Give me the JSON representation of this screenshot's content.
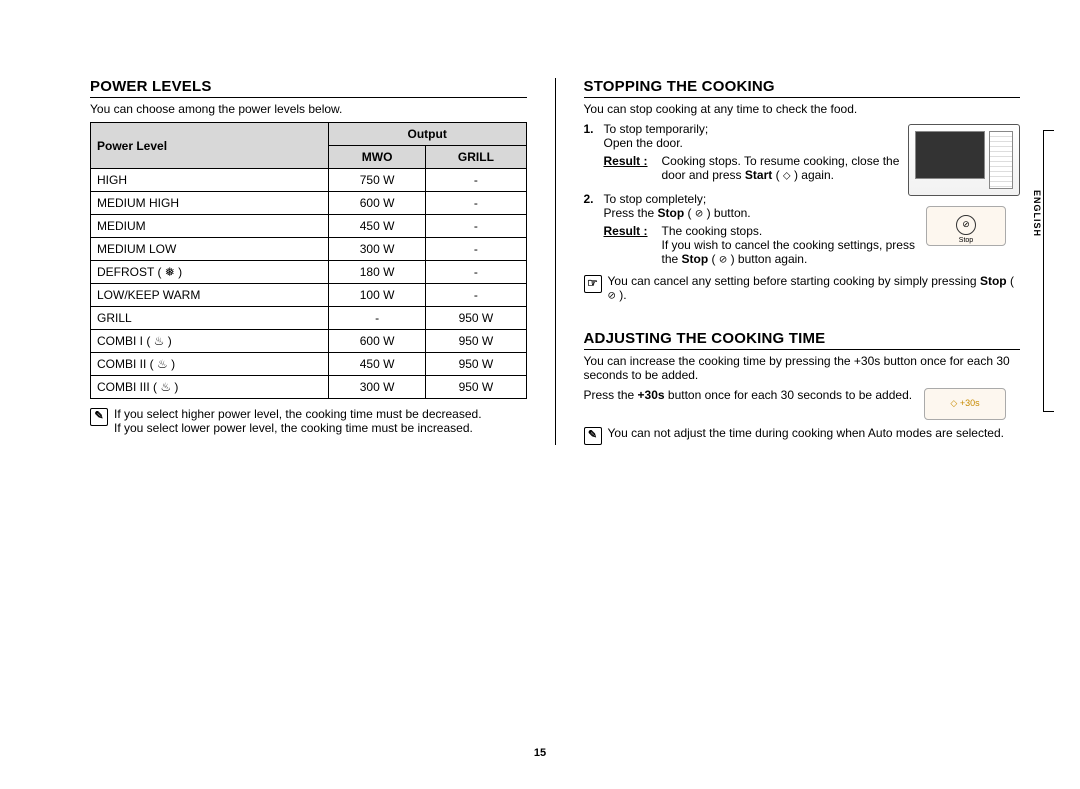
{
  "page_number": "15",
  "side_language": "ENGLISH",
  "left": {
    "heading": "POWER LEVELS",
    "intro": "You can choose among the power levels below.",
    "table": {
      "header_level": "Power Level",
      "header_output": "Output",
      "header_mwo": "MWO",
      "header_grill": "GRILL",
      "rows": [
        {
          "level": "HIGH",
          "mwo": "750 W",
          "grill": "-"
        },
        {
          "level": "MEDIUM HIGH",
          "mwo": "600 W",
          "grill": "-"
        },
        {
          "level": "MEDIUM",
          "mwo": "450 W",
          "grill": "-"
        },
        {
          "level": "MEDIUM LOW",
          "mwo": "300 W",
          "grill": "-"
        },
        {
          "level": "DEFROST ( ❅ )",
          "mwo": "180 W",
          "grill": "-"
        },
        {
          "level": "LOW/KEEP WARM",
          "mwo": "100 W",
          "grill": "-"
        },
        {
          "level": "GRILL",
          "mwo": "-",
          "grill": "950 W"
        },
        {
          "level": "COMBI I ( ♨ )",
          "mwo": "600 W",
          "grill": "950 W"
        },
        {
          "level": "COMBI II ( ♨ )",
          "mwo": "450 W",
          "grill": "950 W"
        },
        {
          "level": "COMBI III ( ♨ )",
          "mwo": "300 W",
          "grill": "950 W"
        }
      ]
    },
    "note": "If you select higher power level, the cooking time must be decreased.\nIf you select lower power level, the cooking time must be increased."
  },
  "right": {
    "stopping": {
      "heading": "STOPPING THE COOKING",
      "intro": "You can stop cooking at any time to check the food.",
      "step1_num": "1.",
      "step1_a": "To stop temporarily;",
      "step1_b": "Open the door.",
      "result1_label": "Result :",
      "result1_a": "Cooking stops. To resume cooking, close the door and press ",
      "result1_start": "Start",
      "result1_b": " ( ",
      "result1_sym": "◇",
      "result1_c": " ) again.",
      "step2_num": "2.",
      "step2_a": "To stop completely;",
      "step2_b": "Press the ",
      "step2_stop": "Stop",
      "step2_c": " ( ",
      "step2_sym": "⊘",
      "step2_d": " ) button.",
      "result2_label": "Result :",
      "result2_a": "The cooking stops.",
      "result2_b": "If you wish to cancel the cooking settings, press the ",
      "result2_stop": "Stop",
      "result2_c": " ( ",
      "result2_sym": "⊘",
      "result2_d": " ) button again.",
      "hand_note_a": "You can cancel any setting before starting cooking by simply pressing ",
      "hand_note_stop": "Stop",
      "hand_note_b": " ( ",
      "hand_note_sym": "⊘",
      "hand_note_c": " ).",
      "btn_label": "Stop"
    },
    "adjusting": {
      "heading": "ADJUSTING THE COOKING TIME",
      "intro": "You can increase the cooking time by pressing the +30s button once for each 30 seconds to be added.",
      "line_a": "Press the ",
      "line_30s": "+30s",
      "line_b": " button once for each 30 seconds to be added.",
      "note": "You can not adjust the time during cooking when Auto modes are selected.",
      "btn_label": "◇ +30s"
    }
  }
}
